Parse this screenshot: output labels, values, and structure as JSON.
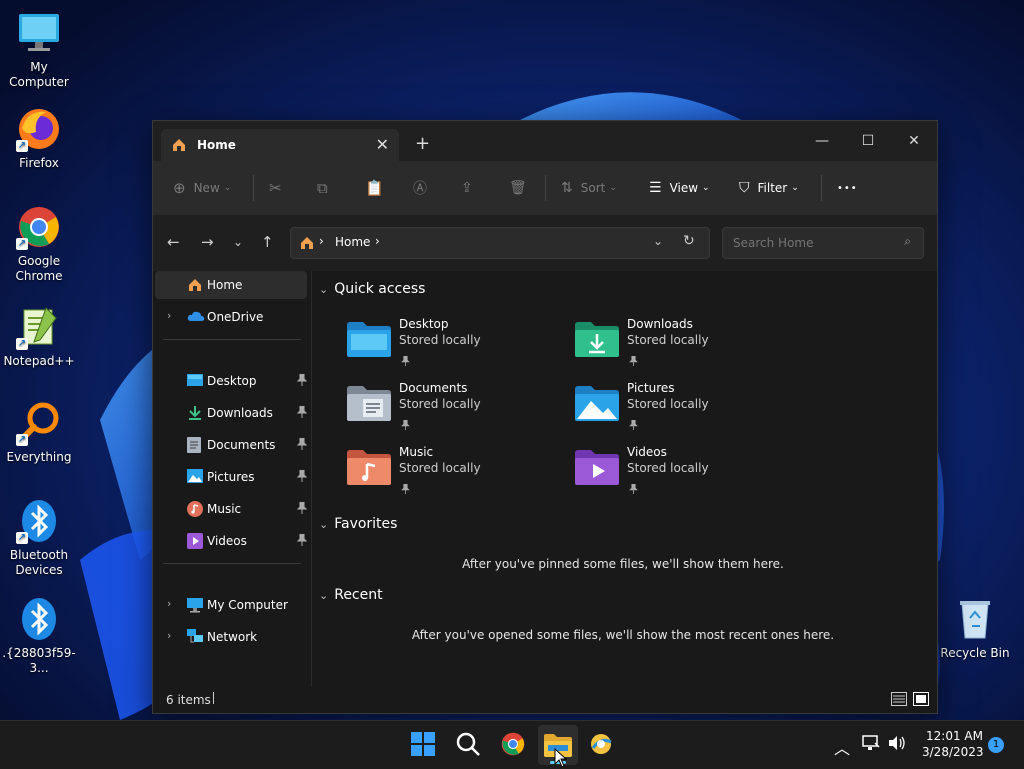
{
  "desktop": {
    "icons": [
      {
        "label": "My Computer"
      },
      {
        "label": "Firefox"
      },
      {
        "label": "Google Chrome"
      },
      {
        "label": "Notepad++"
      },
      {
        "label": "Everything"
      },
      {
        "label": "Bluetooth Devices"
      },
      {
        "label": ".{28803f59-3..."
      },
      {
        "label": "Recycle Bin"
      }
    ]
  },
  "window": {
    "tab_title": "Home",
    "new_tab_symbol": "+",
    "commands": {
      "new": "New",
      "sort": "Sort",
      "view": "View",
      "filter": "Filter",
      "more": "•••"
    },
    "address": {
      "location": "Home",
      "search_placeholder": "Search Home"
    },
    "nav": {
      "home": "Home",
      "onedrive": "OneDrive",
      "pinned": [
        "Desktop",
        "Downloads",
        "Documents",
        "Pictures",
        "Music",
        "Videos"
      ],
      "my_computer": "My Computer",
      "network": "Network"
    },
    "sections": {
      "quick_access": "Quick access",
      "favorites": "Favorites",
      "recent": "Recent"
    },
    "quick_access_items": [
      {
        "name": "Desktop",
        "sub": "Stored locally"
      },
      {
        "name": "Downloads",
        "sub": "Stored locally"
      },
      {
        "name": "Documents",
        "sub": "Stored locally"
      },
      {
        "name": "Pictures",
        "sub": "Stored locally"
      },
      {
        "name": "Music",
        "sub": "Stored locally"
      },
      {
        "name": "Videos",
        "sub": "Stored locally"
      }
    ],
    "favorites_empty": "After you've pinned some files, we'll show them here.",
    "recent_empty": "After you've opened some files, we'll show the most recent ones here.",
    "status": {
      "items": "6 items"
    }
  },
  "taskbar": {
    "time": "12:01 AM",
    "date": "3/28/2023",
    "notification_count": "1"
  },
  "colors": {
    "accent": "#0067c0",
    "window_bg": "#191919",
    "commandbar_bg": "#2b2b2b",
    "folder_yellow": "#f5c342"
  }
}
